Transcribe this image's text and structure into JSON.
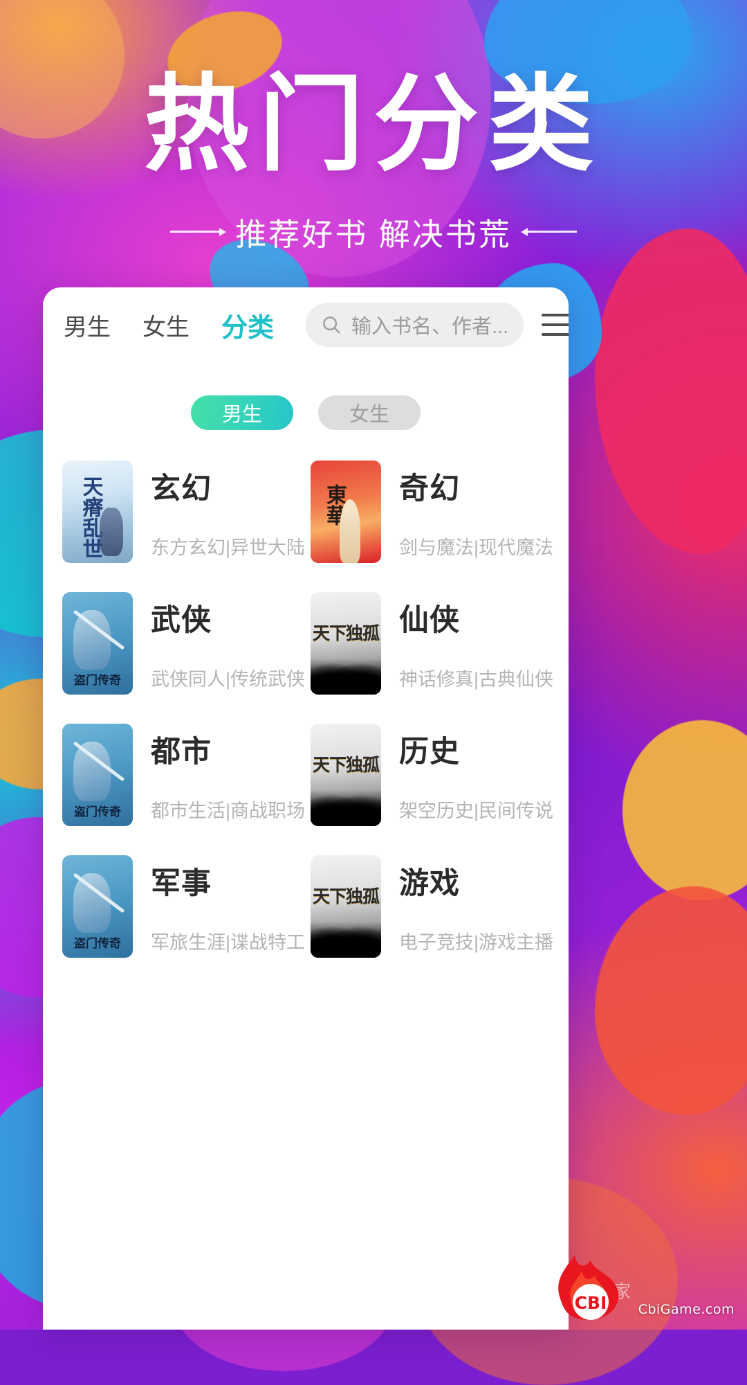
{
  "hero": {
    "title": "热门分类",
    "subtitle": "推荐好书  解决书荒"
  },
  "nav": {
    "tabs": [
      {
        "label": "男生",
        "active": false
      },
      {
        "label": "女生",
        "active": false
      },
      {
        "label": "分类",
        "active": true
      }
    ],
    "search": {
      "icon": "search-icon",
      "placeholder": "输入书名、作者...",
      "value": ""
    },
    "menu_icon": "hamburger-menu-icon"
  },
  "filter": {
    "pills": [
      {
        "label": "男生",
        "selected": true
      },
      {
        "label": "女生",
        "selected": false
      }
    ]
  },
  "categories": [
    {
      "title": "玄幻",
      "subtitle": "东方玄幻|异世大陆",
      "cover": "cv-blue",
      "cover_mark": "天瘠乱世"
    },
    {
      "title": "奇幻",
      "subtitle": "剑与魔法|现代魔法",
      "cover": "cv-red",
      "cover_mark": "東華"
    },
    {
      "title": "武侠",
      "subtitle": "武侠同人|传统武侠",
      "cover": "cv-sword",
      "cover_mark": "盗门传奇"
    },
    {
      "title": "仙侠",
      "subtitle": "神话修真|古典仙侠",
      "cover": "cv-gray",
      "cover_mark": "天下独孤"
    },
    {
      "title": "都市",
      "subtitle": "都市生活|商战职场",
      "cover": "cv-sword",
      "cover_mark": "盗门传奇"
    },
    {
      "title": "历史",
      "subtitle": "架空历史|民间传说",
      "cover": "cv-gray",
      "cover_mark": "天下独孤"
    },
    {
      "title": "军事",
      "subtitle": "军旅生涯|谍战特工",
      "cover": "cv-sword",
      "cover_mark": "盗门传奇"
    },
    {
      "title": "游戏",
      "subtitle": "电子竞技|游戏主播",
      "cover": "cv-gray",
      "cover_mark": "天下独孤"
    }
  ],
  "watermark": {
    "logo_label": "CBI",
    "site": "CbiGame.com",
    "cn_text": "玩家"
  },
  "colors": {
    "accent_teal": "#1fc0c8",
    "pill_gradient_from": "#46e0a8",
    "pill_gradient_to": "#27c6c9",
    "title_text": "#2b2b2b",
    "subtitle_text": "#b4b4b4",
    "card_bg": "#ffffff",
    "search_bg": "#eeeeee"
  }
}
